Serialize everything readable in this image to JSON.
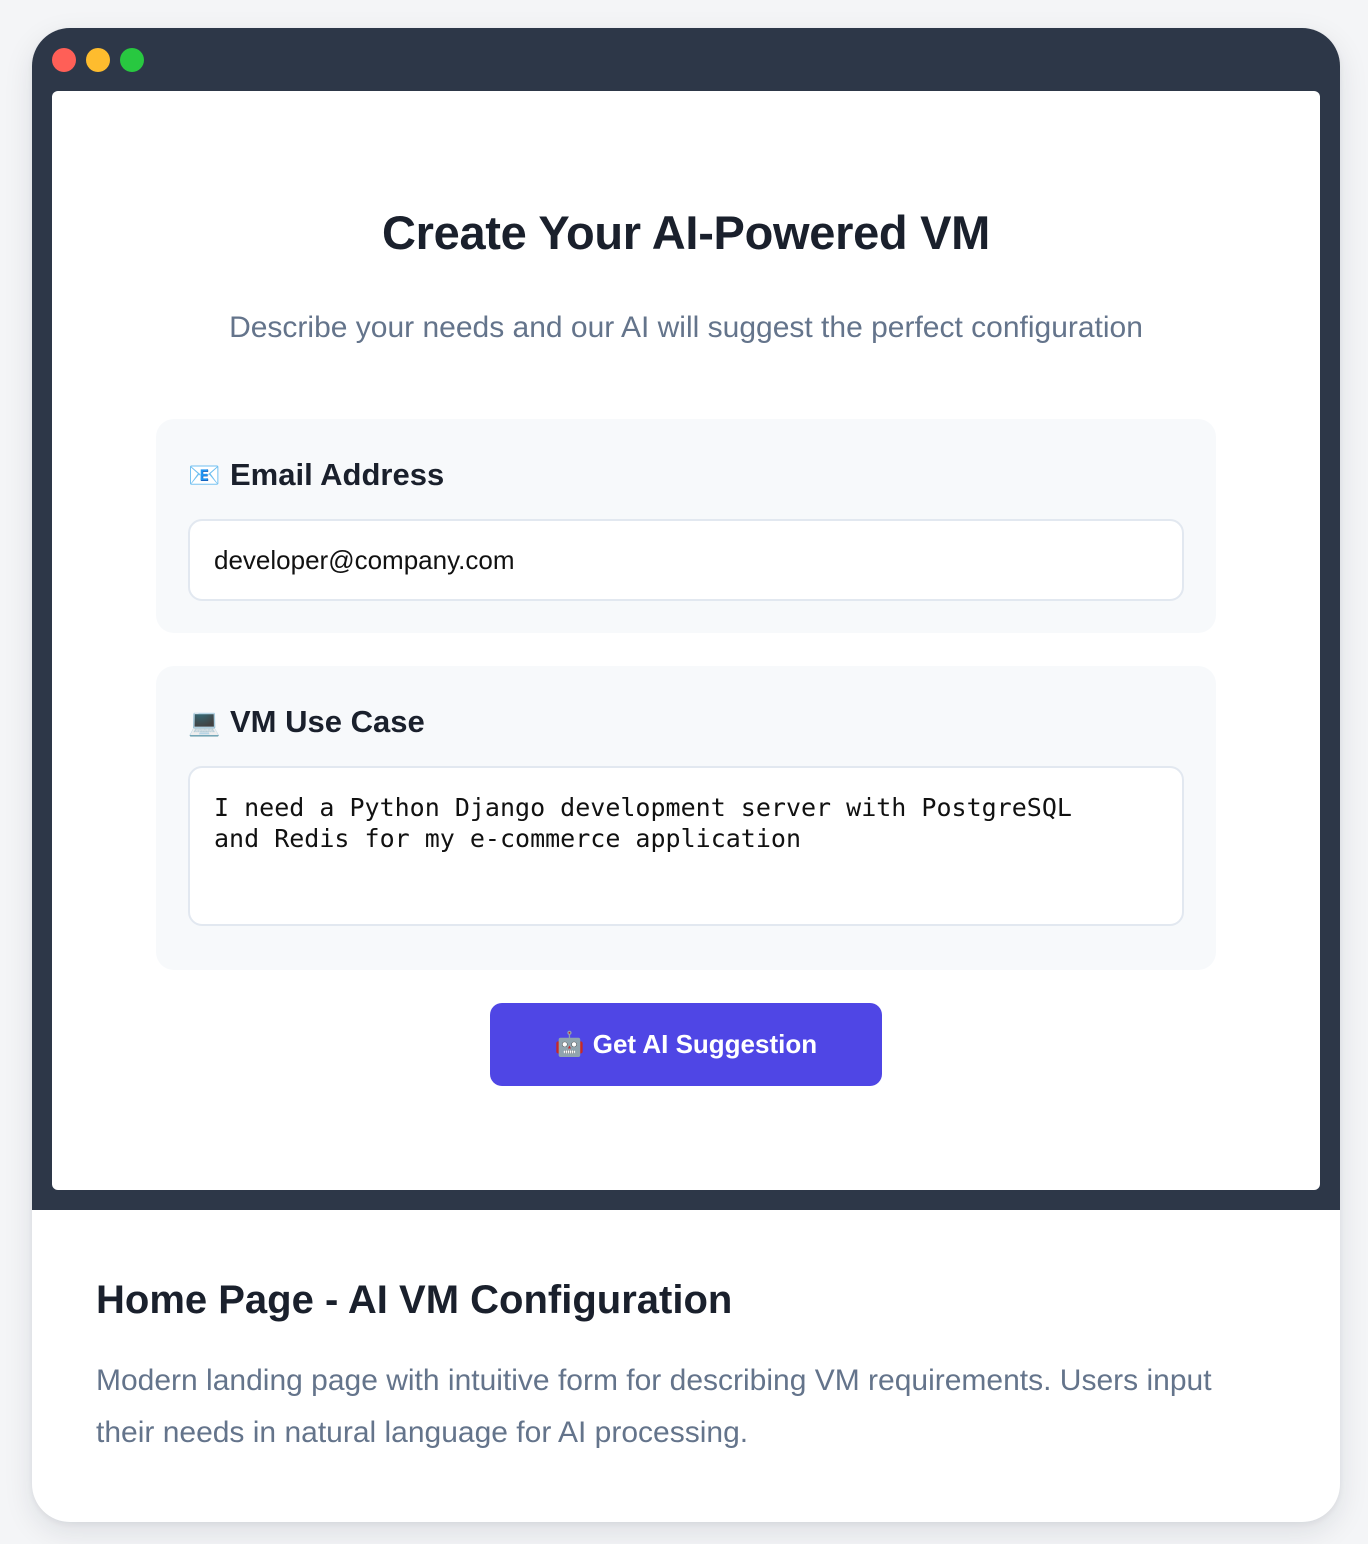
{
  "window": {
    "controls": [
      "close",
      "minimize",
      "maximize"
    ]
  },
  "hero": {
    "title": "Create Your AI-Powered VM",
    "subtitle": "Describe your needs and our AI will suggest the perfect configuration"
  },
  "form": {
    "email": {
      "icon": "envelope-icon",
      "icon_glyph": "📧",
      "label": "Email Address",
      "value": "developer@company.com"
    },
    "use_case": {
      "icon": "laptop-icon",
      "icon_glyph": "💻",
      "label": "VM Use Case",
      "value": "I need a Python Django development server with PostgreSQL\nand Redis for my e-commerce application"
    },
    "submit": {
      "icon": "robot-icon",
      "icon_glyph": "🤖",
      "label": "Get AI Suggestion",
      "color": "#4f46e5"
    }
  },
  "caption": {
    "title": "Home Page - AI VM Configuration",
    "description": "Modern landing page with intuitive form for describing VM requirements. Users input their needs in natural language for AI processing."
  },
  "colors": {
    "window_frame": "#2d3748",
    "close": "#ff5f57",
    "minimize": "#febc2e",
    "maximize": "#28c840",
    "accent": "#4f46e5"
  }
}
